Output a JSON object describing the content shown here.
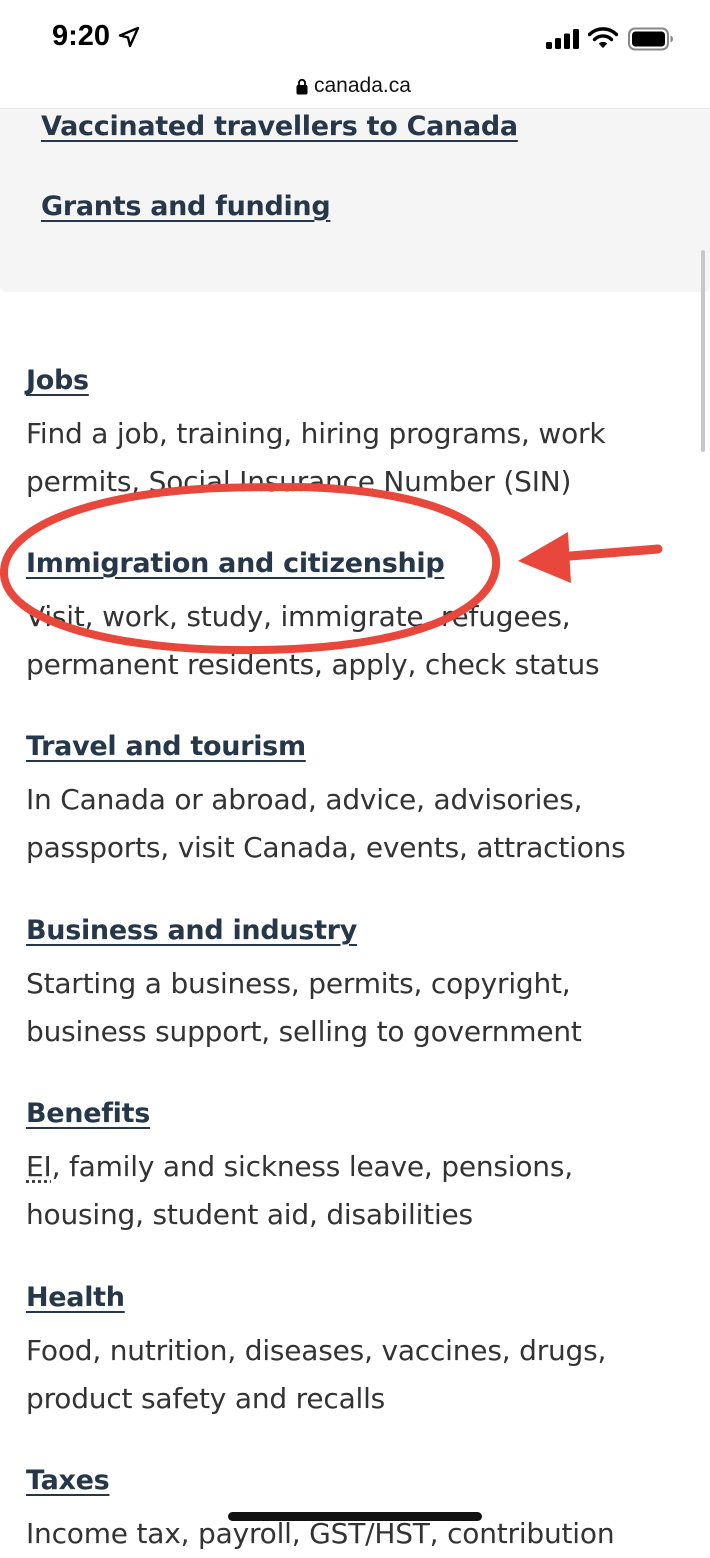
{
  "status_bar": {
    "time": "9:20",
    "icons": [
      "location-arrow-icon",
      "cellular-signal-icon",
      "wifi-icon",
      "battery-icon"
    ]
  },
  "browser": {
    "url": "canada.ca",
    "url_icon": "lock-icon"
  },
  "featured_links": [
    {
      "label": "Vaccinated travellers to Canada"
    },
    {
      "label": "Grants and funding"
    }
  ],
  "topics": [
    {
      "title": "Jobs",
      "desc_lines": [
        "Find a job, training, hiring programs, work",
        "permits, Social Insurance Number (SIN)"
      ]
    },
    {
      "title": "Immigration and citizenship",
      "desc_lines": [
        "Visit, work, study, immigrate, refugees,",
        "permanent residents, apply, check status"
      ]
    },
    {
      "title": "Travel and tourism",
      "desc_lines": [
        "In Canada or abroad, advice, advisories,",
        "passports, visit Canada, events, attractions"
      ]
    },
    {
      "title": "Business and industry",
      "desc_lines": [
        "Starting a business, permits, copyright,",
        "business support, selling to government"
      ]
    },
    {
      "title": "Benefits",
      "desc_abbr": "EI",
      "desc_lines": [
        ", family and sickness leave, pensions,",
        "housing, student aid, disabilities"
      ]
    },
    {
      "title": "Health",
      "desc_lines": [
        "Food, nutrition, diseases, vaccines, drugs,",
        "product safety and recalls"
      ]
    },
    {
      "title": "Taxes",
      "desc_lines": [
        "Income tax, payroll, GST/HST, contribution"
      ]
    }
  ],
  "colors": {
    "link": "#26374a",
    "text": "#333333",
    "featured_bg": "#f5f5f5",
    "annotation": "#e8473b"
  }
}
